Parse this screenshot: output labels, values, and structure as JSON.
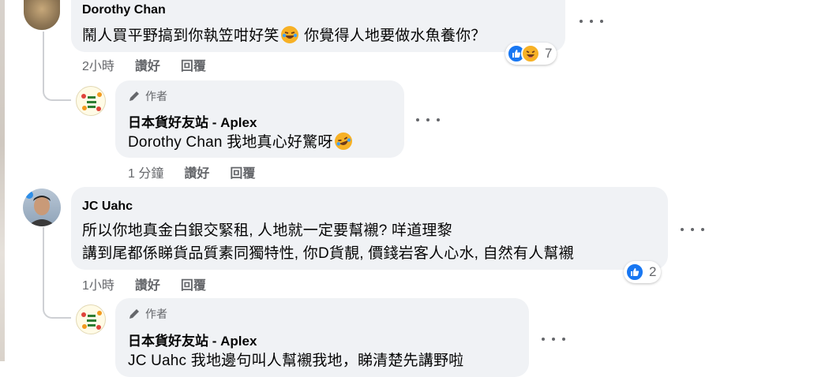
{
  "comments": [
    {
      "name": "Dorothy Chan",
      "text_before_emoji": "鬧人買平野搞到你執笠咁好笑",
      "text_after_emoji": "你覺得人地要做水魚養你？",
      "emoji": "laughing-tears-icon",
      "time": "2小時",
      "like_label": "讚好",
      "reply_label": "回覆",
      "reactions": [
        "like-icon",
        "haha-icon"
      ],
      "reaction_count": "7",
      "replies": [
        {
          "author_badge": "作者",
          "name": "日本貨好友站 - Aplex",
          "mention": "Dorothy Chan",
          "text": "我地真心好驚呀",
          "emoji": "rofl-icon",
          "time": "1 分鐘",
          "like_label": "讚好",
          "reply_label": "回覆"
        }
      ]
    },
    {
      "name": "JC Uahc",
      "line1": "所以你地真金白銀交緊租, 人地就一定要幫襯? 咩道理黎",
      "line2": "講到尾都係睇貨品質素同獨特性, 你D貨靚, 價錢岩客人心水, 自然有人幫襯",
      "time": "1小時",
      "like_label": "讚好",
      "reply_label": "回覆",
      "reactions": [
        "like-icon"
      ],
      "reaction_count": "2",
      "replies": [
        {
          "author_badge": "作者",
          "name": "日本貨好友站 - Aplex",
          "mention": "JC Uahc",
          "text": "我地邊句叫人幫襯我地，睇清楚先講野啦"
        }
      ]
    }
  ],
  "colors": {
    "bubble": "#f0f2f5",
    "meta_text": "#65676b",
    "like_blue": "#1877f2",
    "haha_yellow": "#f7b125"
  }
}
